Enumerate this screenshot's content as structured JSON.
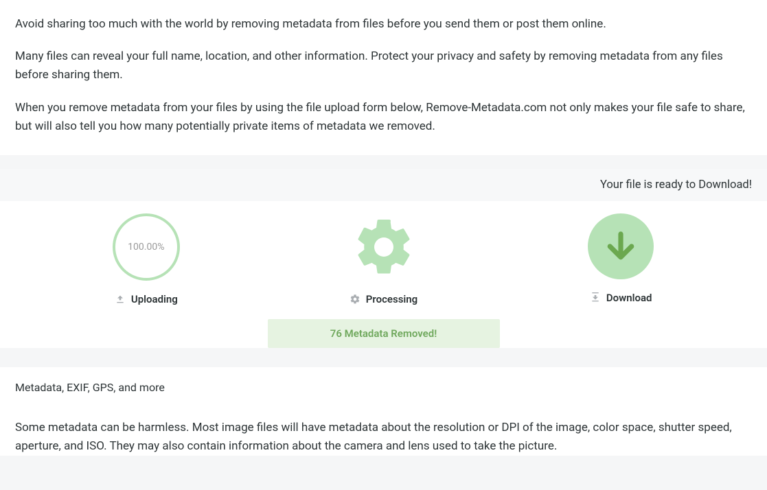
{
  "intro": {
    "p1": "Avoid sharing too much with the world by removing metadata from files before you send them or post them online.",
    "p2": "Many files can reveal your full name, location, and other information. Protect your privacy and safety by removing metadata from any files before sharing them.",
    "p3": "When you remove metadata from your files by using the file upload form below, Remove-Metadata.com not only makes your file safe to share, but will also tell you how many potentially private items of metadata we removed."
  },
  "status": {
    "ready_text": "Your file is ready to Download!"
  },
  "steps": {
    "upload": {
      "percent": "100.00%",
      "label": "Uploading"
    },
    "processing": {
      "label": "Processing"
    },
    "download": {
      "label": "Download"
    }
  },
  "removed_badge": "76 Metadata Removed!",
  "meta_info": {
    "subhead": "Metadata, EXIF, GPS, and more",
    "body": "Some metadata can be harmless. Most image files will have metadata about the resolution or DPI of the image, color space, shutter speed, aperture, and ISO. They may also contain information about the camera and lens used to take the picture."
  }
}
